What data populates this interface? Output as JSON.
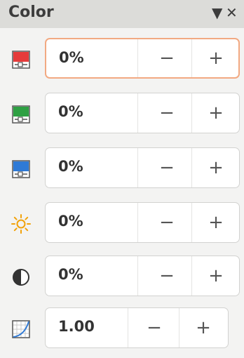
{
  "panel": {
    "title": "Color",
    "menu_icon": "▼",
    "close_icon": "✕"
  },
  "rows": [
    {
      "name": "red",
      "value": "0%",
      "icon": "red-channel-icon"
    },
    {
      "name": "green",
      "value": "0%",
      "icon": "green-channel-icon"
    },
    {
      "name": "blue",
      "value": "0%",
      "icon": "blue-channel-icon"
    },
    {
      "name": "brightness",
      "value": "0%",
      "icon": "brightness-icon"
    },
    {
      "name": "contrast",
      "value": "0%",
      "icon": "contrast-icon"
    },
    {
      "name": "gamma",
      "value": "1.00",
      "icon": "gamma-icon"
    }
  ],
  "buttons": {
    "minus": "−",
    "plus": "+"
  },
  "colors": {
    "red": "#e53b3b",
    "green": "#2ea043",
    "blue": "#2f7ad6",
    "sun": "#f2a20a",
    "focus": "#f2a982"
  }
}
